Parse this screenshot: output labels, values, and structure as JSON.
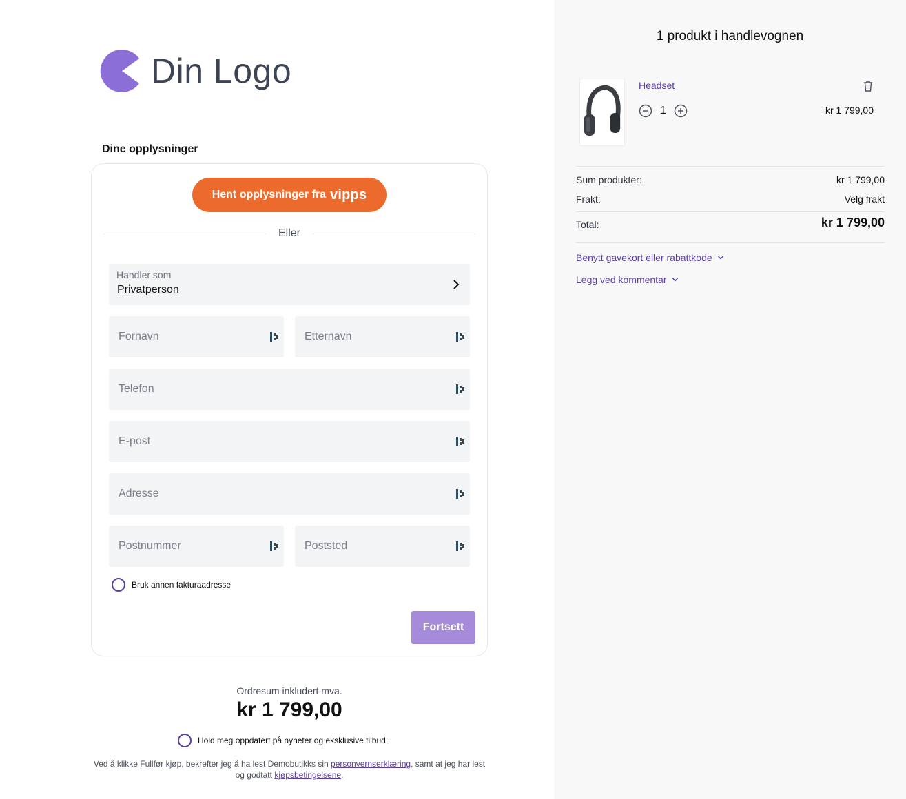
{
  "brand": {
    "logo_text": "Din Logo",
    "color": "#8b6fd6"
  },
  "form": {
    "section_title": "Dine opplysninger",
    "vipps_button_label": "Hent opplysninger fra",
    "vipps_logo_text": "vipps",
    "divider_text": "Eller",
    "customer_type": {
      "label": "Handler som",
      "value": "Privatperson"
    },
    "fields": {
      "first_name": "Fornavn",
      "last_name": "Etternavn",
      "phone": "Telefon",
      "email": "E-post",
      "address": "Adresse",
      "postal_code": "Postnummer",
      "city": "Poststed"
    },
    "billing_address_option": "Bruk annen fakturaadresse",
    "continue_label": "Fortsett"
  },
  "order_summary": {
    "label": "Ordresum inkludert mva.",
    "total": "kr 1 799,00",
    "newsletter_option": "Hold meg oppdatert på nyheter og eksklusive tilbud.",
    "terms_part1": "Ved å klikke Fullfør kjøp, bekrefter jeg å ha lest Demobutikks sin ",
    "terms_link_privacy": "personvernserklæring",
    "terms_part2": ", samt at jeg har lest og godtatt ",
    "terms_link_terms": "kjøpsbetingelsene",
    "terms_part3": "."
  },
  "cart": {
    "title": "1 produkt i handlevognen",
    "item": {
      "name": "Headset",
      "quantity": "1",
      "price": "kr 1 799,00"
    },
    "sum_label": "Sum produkter:",
    "sum_value": "kr 1 799,00",
    "shipping_label": "Frakt:",
    "shipping_value": "Velg frakt",
    "total_label": "Total:",
    "total_value": "kr 1 799,00",
    "gift_card_link": "Benytt gavekort eller rabattkode",
    "comment_link": "Legg ved kommentar"
  },
  "colors": {
    "accent": "#5b3fa6",
    "vipps_orange": "#ec6a2c",
    "continue_button": "#a78bdb",
    "field_bg": "#f3f4f6",
    "sidebar_bg": "#f8f8f8"
  }
}
